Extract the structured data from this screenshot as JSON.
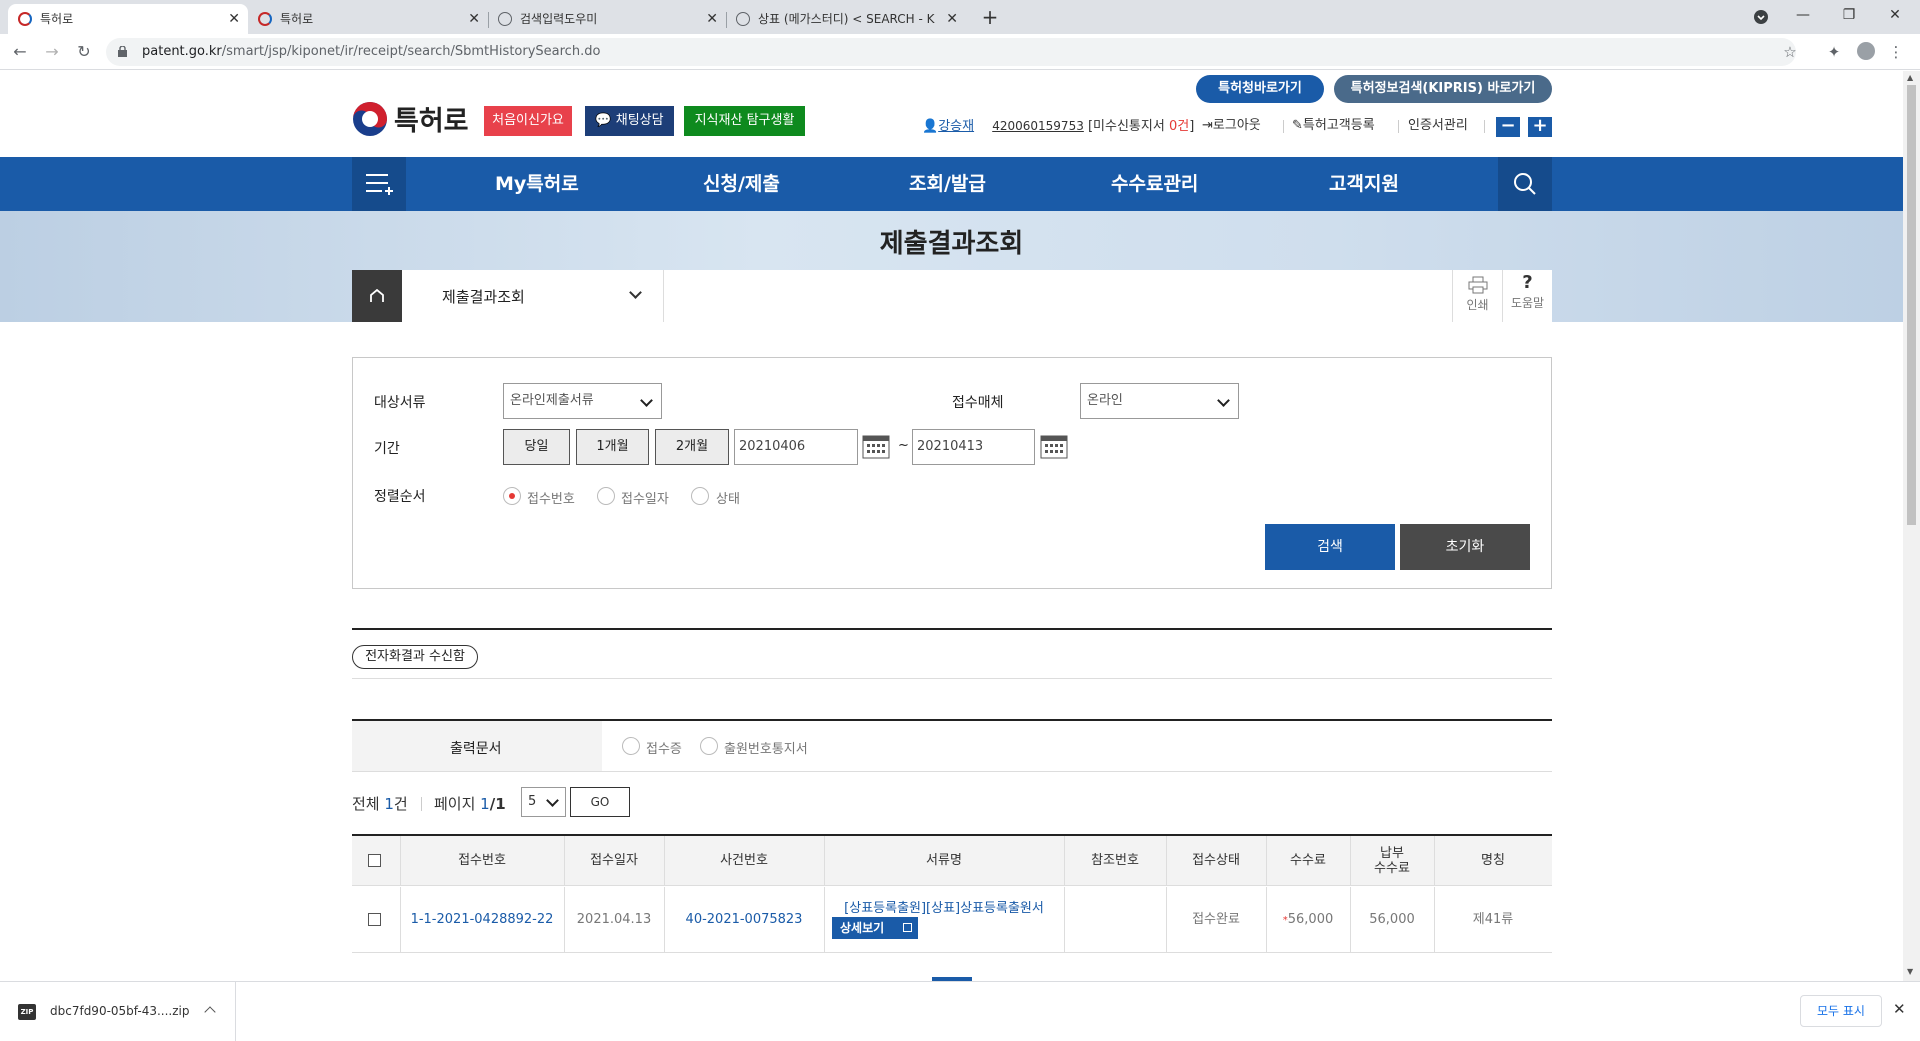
{
  "browser": {
    "tabs": [
      {
        "title": "특허로",
        "active": true
      },
      {
        "title": "특허로",
        "active": false
      },
      {
        "title": "검색입력도우미",
        "active": false
      },
      {
        "title": "상표 (메가스터디) < SEARCH - K",
        "active": false
      }
    ],
    "new_tab": "+",
    "url_host": "patent.go.kr",
    "url_path": "/smart/jsp/kiponet/ir/receipt/search/SbmtHistorySearch.do"
  },
  "header": {
    "btn_kipo": "특허청바로가기",
    "btn_kipris": "특허정보검색(KIPRIS) 바로가기",
    "logo_text": "특허로",
    "badge_first": "처음이신가요",
    "badge_chat": "채팅상담",
    "badge_ip": "지식재산 탐구생활",
    "user_name": "강승재",
    "user_id": "420060159753",
    "unread_prefix": "[미수신통지서 ",
    "unread_count": "0건",
    "unread_suffix": "]",
    "logout": "로그아웃",
    "register": "특허고객등록",
    "cert": "인증서관리",
    "zoom_out": "−",
    "zoom_in": "+"
  },
  "gnb": {
    "items": [
      "My특허로",
      "신청/제출",
      "조회/발급",
      "수수료관리",
      "고객지원"
    ]
  },
  "page": {
    "title": "제출결과조회",
    "crumb": "제출결과조회",
    "print": "인쇄",
    "help": "도움말",
    "help_glyph": "?"
  },
  "search": {
    "doc_label": "대상서류",
    "doc_value": "온라인제출서류",
    "media_label": "접수매체",
    "media_value": "온라인",
    "period_label": "기간",
    "period_today": "당일",
    "period_1m": "1개월",
    "period_2m": "2개월",
    "date_from": "20210406",
    "date_sep": "~",
    "date_to": "20210413",
    "sort_label": "정렬순서",
    "sort_options": [
      "접수번호",
      "접수일자",
      "상태"
    ],
    "sort_selected": "접수번호",
    "search_btn": "검색",
    "reset_btn": "초기화"
  },
  "results": {
    "mailbox_btn": "전자화결과 수신함",
    "output_label": "출력문서",
    "output_options": [
      "접수증",
      "출원번호통지서"
    ],
    "total_prefix": "전체 ",
    "total_count": "1",
    "total_suffix": "건",
    "page_prefix": "페이지 ",
    "page_current": "1",
    "page_total": "/1",
    "page_size": "5",
    "go_btn": "GO",
    "columns": [
      "접수번호",
      "접수일자",
      "사건번호",
      "서류명",
      "참조번호",
      "접수상태",
      "수수료",
      "납부\n수수료",
      "명칭"
    ],
    "rows": [
      {
        "receipt_no": "1-1-2021-0428892-22",
        "date": "2021.04.13",
        "case_no": "40-2021-0075823",
        "doc_name": "[상표등록출원][상표]상표등록출원서",
        "detail_btn": "상세보기",
        "ref_no": "",
        "status": "접수완료",
        "fee": "56,000",
        "fee_mark": "*",
        "paid_fee": "56,000",
        "name": "제41류"
      }
    ]
  },
  "download_bar": {
    "file": "dbc7fd90-05bf-43....zip",
    "show_all": "모두 표시"
  },
  "colors": {
    "primary": "#1a5ba8",
    "kipris": "#4a6a8a",
    "badge_red": "#e8414b",
    "badge_navy": "#1d3e78",
    "badge_green": "#0e8a1e",
    "reset": "#4a4a4a",
    "link": "#1a5ba8"
  }
}
